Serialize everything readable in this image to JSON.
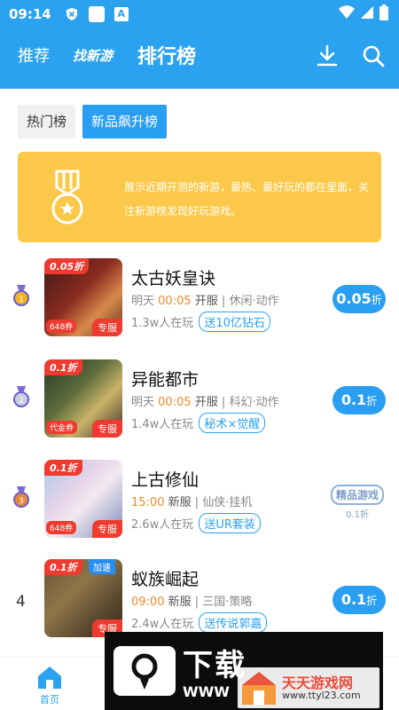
{
  "status": {
    "time": "09:14"
  },
  "nav": {
    "tab_recommend": "推荐",
    "tab_new_games": "找新游",
    "tab_ranking": "排行榜",
    "download_icon": "download-icon",
    "search_icon": "search-icon"
  },
  "chips": {
    "hot": "热门榜",
    "new_rising": "新品飙升榜"
  },
  "banner": {
    "text": "展示近期开测的新游，最热、最好玩的都在里面，关注新游榜发现好玩游戏。"
  },
  "games": [
    {
      "rank": "1",
      "tag": "0.05折",
      "coupon": "648券",
      "server_tag": "专服",
      "title": "太古妖皇诀",
      "day": "明天",
      "time": "00:05",
      "open": "开服",
      "genre": "休闲·动作",
      "players": "1.3w人在玩",
      "gift": "送10亿钻石",
      "discount_value": "0.05",
      "discount_unit": "折"
    },
    {
      "rank": "2",
      "tag": "0.1折",
      "coupon": "代金券",
      "server_tag": "专服",
      "title": "异能都市",
      "day": "明天",
      "time": "00:05",
      "open": "开服",
      "genre": "科幻·动作",
      "players": "1.4w人在玩",
      "gift": "秘术×觉醒",
      "discount_value": "0.1",
      "discount_unit": "折"
    },
    {
      "rank": "3",
      "tag": "0.1折",
      "coupon": "648券",
      "server_tag": "专服",
      "title": "上古修仙",
      "day": "",
      "time": "15:00",
      "open": "新服",
      "genre": "仙侠·挂机",
      "players": "2.6w人在玩",
      "gift": "送UR套装",
      "seal_line1": "精品游戏",
      "seal_line2": "0.1折"
    },
    {
      "rank": "4",
      "tag": "0.1折",
      "tag2": "加速",
      "server_tag": "专服",
      "title": "蚁族崛起",
      "day": "",
      "time": "09:00",
      "open": "新服",
      "genre": "三国·策略",
      "players": "2.4w人在玩",
      "gift": "送传说郭嘉",
      "discount_value": "0.1",
      "discount_unit": "折"
    }
  ],
  "bottom_nav": {
    "home": "首页"
  },
  "watermarks": {
    "big_text": "下载",
    "big_url": "WWW",
    "site_name": "天天游戏网",
    "site_url": "www.ttyl23.com"
  },
  "colors": {
    "primary": "#2aa2f0",
    "accent_orange": "#f08a24",
    "banner": "#fcc84a",
    "tag_red": "#ee3b2f"
  }
}
